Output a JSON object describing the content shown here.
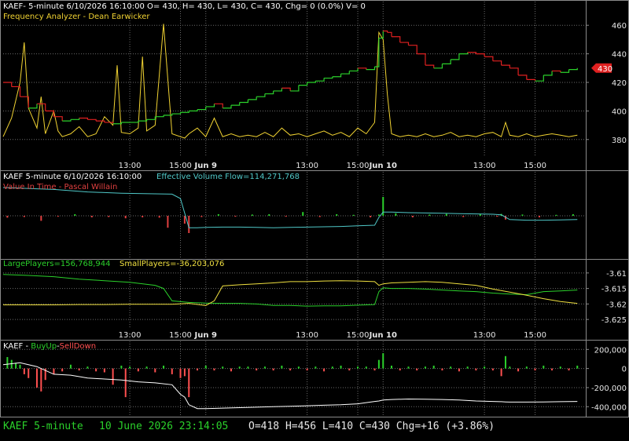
{
  "colors": {
    "grid": "#6a6a6a",
    "border": "#8a8a8a",
    "price_up": "#2bd12b",
    "price_down": "#e02020",
    "freq": "#f0d232",
    "evf": "#4fc7c7",
    "vit": "#e04040",
    "large": "#2bd12b",
    "small": "#f0e040",
    "buy": "#2bd12b",
    "sell": "#ff5050",
    "cum": "#ffffff",
    "last_tag": "#e02020",
    "status_green": "#2bd12b"
  },
  "panel1": {
    "line1": "KAEF- 5-minute 6/10/2026 16:10:00 O= 430, H= 430, L= 430, C= 430, Chg= 0 (0.0%) V= 0",
    "line2": "Frequency Analyzer - Dean Earwicker",
    "price_tag": "430"
  },
  "panel2": {
    "label_main": "KAEF 5-minute  6/10/2026 16:10:00",
    "label_evf": "Effective Volume Flow=114,271,768",
    "label_vit": "Value In Time - Pascal Willain"
  },
  "panel3": {
    "label_large": "LargePlayers=156,768,944",
    "label_small": "SmallPlayers=-36,203,076"
  },
  "panel4": {
    "label_sym": "KAEF - ",
    "label_buy": "BuyUp",
    "label_dash": "-",
    "label_sell": "SellDown"
  },
  "time_axis": {
    "labels": [
      {
        "x": 30,
        "text": "13:00",
        "bold": false
      },
      {
        "x": 42,
        "text": "15:00",
        "bold": false
      },
      {
        "x": 48,
        "text": "Jun 9",
        "bold": true
      },
      {
        "x": 72,
        "text": "13:00",
        "bold": false
      },
      {
        "x": 84,
        "text": "15:00",
        "bold": false
      },
      {
        "x": 90,
        "text": "Jun 10",
        "bold": true
      },
      {
        "x": 114,
        "text": "13:00",
        "bold": false
      },
      {
        "x": 126,
        "text": "15:00",
        "bold": false
      }
    ]
  },
  "status_bar": {
    "symbol": "KAEF  5-minute",
    "datetime": "10 June 2026 23:14:05",
    "ohlc": "O=418  H=456  L=410  C=430  Chg=+16 (+3.86%)"
  },
  "chart_data": [
    {
      "name": "price",
      "type": "line",
      "x_domain": [
        0,
        138
      ],
      "ylim": [
        370,
        470
      ],
      "yticks": [
        380,
        400,
        420,
        440,
        460
      ],
      "grid": true,
      "x": [
        0,
        2,
        4,
        6,
        8,
        10,
        12,
        14,
        16,
        18,
        20,
        22,
        24,
        26,
        28,
        30,
        32,
        34,
        36,
        38,
        40,
        42,
        44,
        46,
        48,
        50,
        52,
        54,
        56,
        58,
        60,
        62,
        64,
        66,
        68,
        70,
        72,
        74,
        76,
        78,
        80,
        82,
        84,
        86,
        88,
        89,
        90,
        91,
        92,
        94,
        96,
        98,
        100,
        102,
        104,
        106,
        108,
        110,
        112,
        114,
        116,
        118,
        120,
        122,
        124,
        126,
        128,
        130,
        132,
        134,
        136
      ],
      "close": [
        420,
        417,
        410,
        402,
        405,
        400,
        396,
        393,
        394,
        395,
        394,
        393,
        392,
        391,
        392,
        392,
        393,
        394,
        396,
        397,
        398,
        399,
        400,
        401,
        403,
        405,
        402,
        404,
        406,
        408,
        410,
        412,
        414,
        416,
        414,
        418,
        420,
        421,
        423,
        424,
        426,
        428,
        430,
        429,
        431,
        451,
        456,
        455,
        452,
        448,
        446,
        440,
        432,
        430,
        433,
        436,
        440,
        441,
        440,
        438,
        435,
        432,
        430,
        425,
        422,
        421,
        425,
        428,
        427,
        429,
        430
      ]
    },
    {
      "name": "frequency_analyzer",
      "type": "line",
      "x_domain": [
        0,
        138
      ],
      "ylim": [
        370,
        470
      ],
      "x": [
        0,
        2,
        4,
        5,
        6,
        8,
        9,
        10,
        12,
        13,
        14,
        16,
        18,
        20,
        22,
        24,
        26,
        27,
        28,
        30,
        32,
        33,
        34,
        36,
        38,
        40,
        42,
        43,
        44,
        46,
        48,
        50,
        52,
        54,
        56,
        58,
        60,
        62,
        64,
        66,
        68,
        70,
        72,
        74,
        76,
        78,
        80,
        82,
        84,
        86,
        88,
        89,
        90,
        91,
        92,
        94,
        96,
        98,
        100,
        102,
        104,
        106,
        108,
        110,
        112,
        114,
        116,
        118,
        119,
        120,
        122,
        124,
        126,
        128,
        130,
        132,
        134,
        136
      ],
      "values": [
        382,
        395,
        420,
        448,
        402,
        388,
        410,
        384,
        400,
        386,
        382,
        384,
        389,
        382,
        384,
        396,
        390,
        432,
        385,
        384,
        388,
        438,
        386,
        390,
        461,
        384,
        382,
        381,
        384,
        388,
        382,
        395,
        382,
        384,
        382,
        383,
        382,
        385,
        382,
        388,
        383,
        384,
        382,
        384,
        386,
        383,
        385,
        382,
        388,
        384,
        392,
        455,
        450,
        412,
        384,
        382,
        383,
        382,
        384,
        382,
        383,
        385,
        382,
        383,
        382,
        384,
        385,
        382,
        392,
        383,
        382,
        384,
        382,
        383,
        384,
        383,
        382,
        383
      ]
    },
    {
      "name": "effective_volume_flow",
      "type": "line",
      "x_domain": [
        0,
        138
      ],
      "ylim": [
        -1,
        1
      ],
      "x": [
        0,
        4,
        8,
        12,
        16,
        20,
        24,
        28,
        32,
        36,
        40,
        42,
        44,
        46,
        48,
        52,
        56,
        60,
        64,
        68,
        72,
        76,
        80,
        84,
        88,
        89,
        90,
        92,
        96,
        100,
        104,
        108,
        112,
        116,
        118,
        120,
        124,
        128,
        132,
        136
      ],
      "values": [
        0.9,
        0.88,
        0.86,
        0.84,
        0.8,
        0.76,
        0.74,
        0.72,
        0.71,
        0.7,
        0.69,
        0.55,
        -0.38,
        -0.38,
        -0.37,
        -0.36,
        -0.36,
        -0.37,
        -0.38,
        -0.37,
        -0.36,
        -0.35,
        -0.34,
        -0.32,
        -0.3,
        -0.05,
        0.12,
        0.12,
        0.1,
        0.09,
        0.08,
        0.07,
        0.06,
        0.05,
        0.03,
        -0.12,
        -0.14,
        -0.14,
        -0.13,
        -0.12
      ]
    },
    {
      "name": "value_in_time",
      "type": "bar",
      "x_domain": [
        0,
        138
      ],
      "ylim": [
        -1,
        1
      ],
      "x": [
        1,
        5,
        9,
        13,
        17,
        21,
        25,
        29,
        33,
        37,
        39,
        43,
        44,
        47,
        51,
        55,
        59,
        63,
        67,
        71,
        75,
        79,
        83,
        87,
        89,
        90,
        93,
        97,
        101,
        105,
        109,
        113,
        117,
        118,
        119,
        123,
        127,
        131,
        135
      ],
      "values": [
        -0.06,
        -0.04,
        -0.16,
        -0.03,
        0.05,
        -0.05,
        -0.04,
        -0.08,
        -0.05,
        -0.06,
        -0.38,
        -0.25,
        -0.55,
        -0.04,
        0.05,
        -0.03,
        0.04,
        0.05,
        -0.03,
        0.12,
        -0.04,
        0.05,
        0.03,
        -0.05,
        0.04,
        0.6,
        0.08,
        -0.05,
        0.04,
        0.06,
        -0.04,
        0.05,
        -0.03,
        0.06,
        -0.12,
        0.04,
        -0.05,
        0.03,
        0.05
      ]
    },
    {
      "name": "players",
      "type": "line",
      "x_domain": [
        0,
        138
      ],
      "ylim": [
        -3.627,
        -3.607
      ],
      "yticks": [
        -3.61,
        -3.615,
        -3.62,
        -3.625
      ],
      "series": [
        {
          "name": "LargePlayers",
          "x": [
            0,
            6,
            12,
            18,
            24,
            30,
            36,
            38,
            40,
            44,
            48,
            52,
            56,
            60,
            64,
            68,
            72,
            76,
            80,
            84,
            88,
            89,
            90,
            92,
            96,
            100,
            104,
            108,
            112,
            116,
            120,
            124,
            128,
            132,
            136
          ],
          "values": [
            -3.6105,
            -3.6108,
            -3.6112,
            -3.612,
            -3.6125,
            -3.613,
            -3.614,
            -3.615,
            -3.619,
            -3.6195,
            -3.6197,
            -3.6198,
            -3.6198,
            -3.62,
            -3.6205,
            -3.6205,
            -3.6207,
            -3.6206,
            -3.6206,
            -3.6204,
            -3.6202,
            -3.616,
            -3.6148,
            -3.615,
            -3.615,
            -3.6152,
            -3.6155,
            -3.6158,
            -3.616,
            -3.6165,
            -3.6168,
            -3.617,
            -3.616,
            -3.6158,
            -3.6155
          ]
        },
        {
          "name": "SmallPlayers",
          "x": [
            0,
            6,
            12,
            18,
            24,
            30,
            36,
            40,
            44,
            48,
            50,
            52,
            56,
            60,
            64,
            68,
            72,
            76,
            80,
            84,
            88,
            89,
            90,
            92,
            96,
            100,
            104,
            108,
            112,
            116,
            120,
            124,
            128,
            132,
            136
          ],
          "values": [
            -3.6203,
            -3.6203,
            -3.6203,
            -3.6202,
            -3.6202,
            -3.6201,
            -3.6201,
            -3.6201,
            -3.6198,
            -3.6205,
            -3.619,
            -3.6142,
            -3.6138,
            -3.6135,
            -3.6132,
            -3.6128,
            -3.6128,
            -3.6126,
            -3.6125,
            -3.6126,
            -3.6128,
            -3.614,
            -3.6135,
            -3.6132,
            -3.613,
            -3.6128,
            -3.613,
            -3.6135,
            -3.614,
            -3.6152,
            -3.6162,
            -3.6172,
            -3.6183,
            -3.6192,
            -3.6198
          ]
        }
      ]
    },
    {
      "name": "buyup_selldown",
      "type": "bar",
      "x_domain": [
        0,
        138
      ],
      "ylim": [
        -480000,
        260000
      ],
      "yticks": [
        200000,
        0,
        -200000,
        -400000
      ],
      "ytick_labels": [
        "200,000",
        "0",
        "-200,000",
        "-400,000"
      ],
      "bars_x": [
        1,
        2,
        3,
        4,
        5,
        6,
        8,
        9,
        10,
        12,
        14,
        16,
        18,
        20,
        22,
        24,
        26,
        28,
        29,
        30,
        32,
        34,
        36,
        38,
        40,
        42,
        43,
        44,
        46,
        48,
        50,
        52,
        54,
        56,
        58,
        60,
        62,
        64,
        66,
        68,
        70,
        72,
        74,
        76,
        78,
        80,
        82,
        84,
        86,
        88,
        89,
        90,
        92,
        94,
        96,
        98,
        100,
        102,
        104,
        106,
        108,
        110,
        112,
        114,
        116,
        118,
        119,
        120,
        122,
        124,
        126,
        128,
        130,
        132,
        134,
        136
      ],
      "bars": [
        120000,
        90000,
        60000,
        40000,
        -60000,
        -100000,
        -200000,
        -240000,
        -120000,
        -60000,
        -30000,
        40000,
        -20000,
        20000,
        -30000,
        -40000,
        -170000,
        30000,
        -300000,
        20000,
        -30000,
        20000,
        -40000,
        30000,
        -60000,
        -100000,
        -80000,
        -300000,
        -20000,
        30000,
        -20000,
        20000,
        -30000,
        20000,
        20000,
        -20000,
        20000,
        -20000,
        30000,
        -20000,
        20000,
        -20000,
        20000,
        -30000,
        20000,
        30000,
        -20000,
        20000,
        20000,
        -20000,
        90000,
        160000,
        30000,
        -20000,
        20000,
        -20000,
        20000,
        30000,
        -20000,
        20000,
        -30000,
        20000,
        -20000,
        20000,
        -20000,
        -80000,
        130000,
        20000,
        -30000,
        20000,
        -20000,
        30000,
        -20000,
        20000,
        -20000,
        30000
      ],
      "cum_x": [
        0,
        4,
        8,
        12,
        16,
        20,
        24,
        28,
        32,
        36,
        40,
        42,
        43,
        44,
        46,
        48,
        52,
        56,
        60,
        64,
        68,
        72,
        76,
        80,
        84,
        88,
        89,
        90,
        92,
        96,
        100,
        104,
        108,
        112,
        116,
        118,
        119,
        120,
        124,
        128,
        132,
        136
      ],
      "cum": [
        40000,
        60000,
        20000,
        -60000,
        -70000,
        -100000,
        -110000,
        -120000,
        -140000,
        -150000,
        -170000,
        -270000,
        -300000,
        -380000,
        -420000,
        -420000,
        -415000,
        -410000,
        -405000,
        -400000,
        -395000,
        -390000,
        -385000,
        -380000,
        -370000,
        -345000,
        -340000,
        -330000,
        -325000,
        -320000,
        -322000,
        -325000,
        -330000,
        -340000,
        -345000,
        -348000,
        -350000,
        -352000,
        -352000,
        -350000,
        -348000,
        -345000
      ]
    }
  ]
}
